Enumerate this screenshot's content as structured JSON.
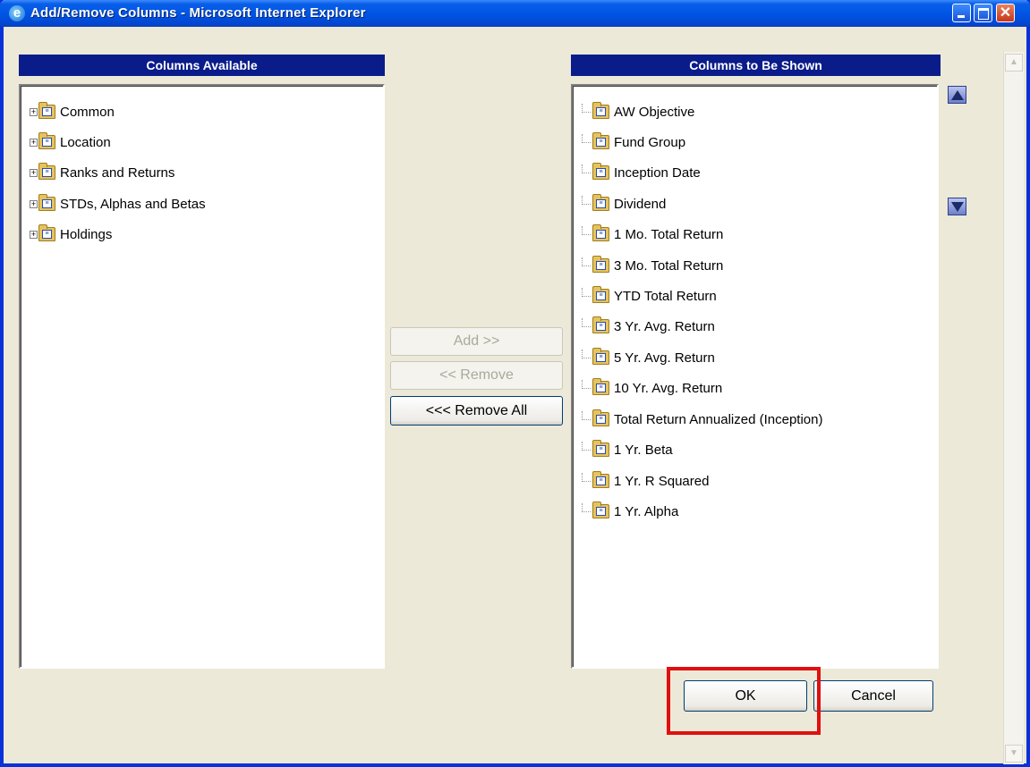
{
  "window": {
    "title": "Add/Remove Columns - Microsoft Internet Explorer"
  },
  "available": {
    "header": "Columns Available",
    "items": [
      "Common",
      "Location",
      "Ranks and Returns",
      "STDs, Alphas and Betas",
      "Holdings"
    ]
  },
  "shown": {
    "header": "Columns to Be Shown",
    "items": [
      "AW Objective",
      "Fund Group",
      "Inception Date",
      "Dividend",
      "1 Mo. Total Return",
      "3 Mo. Total Return",
      "YTD Total Return",
      "3 Yr. Avg. Return",
      "5 Yr. Avg. Return",
      "10 Yr. Avg. Return",
      "Total Return Annualized (Inception)",
      "1 Yr. Beta",
      "1 Yr. R Squared",
      "1 Yr. Alpha"
    ]
  },
  "actions": {
    "add": "Add >>",
    "remove": "<< Remove",
    "remove_all": "<<< Remove All",
    "ok": "OK",
    "cancel": "Cancel"
  },
  "icons": {
    "expander": "+",
    "folder_badge": "≡",
    "up": "move-up-icon",
    "down": "move-down-icon"
  },
  "colors": {
    "header_bg": "#0a1c8a",
    "titlebar": "#0055e5",
    "highlight": "#e0100f"
  }
}
